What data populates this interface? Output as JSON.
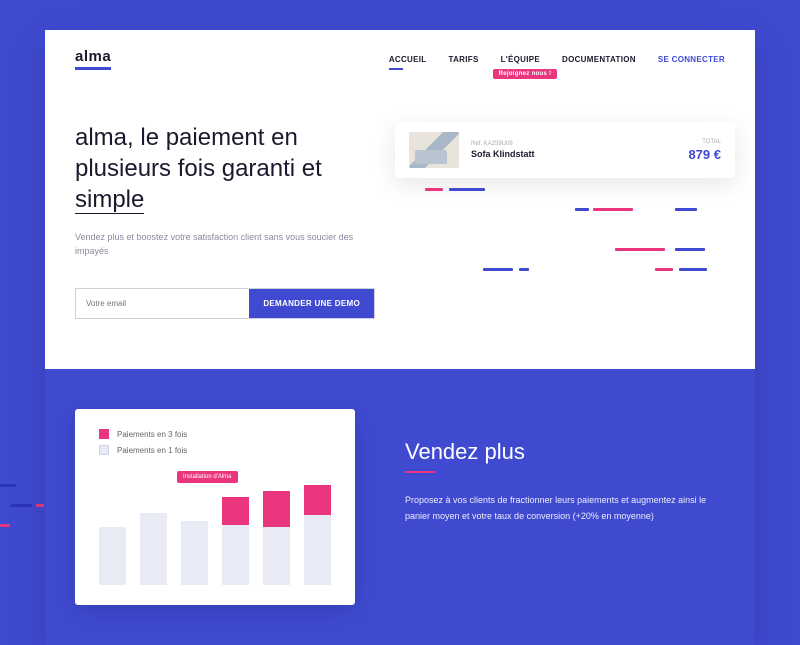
{
  "logo": "alma",
  "nav": {
    "accueil": "ACCUEIL",
    "tarifs": "TARIFS",
    "equipe": "L'ÉQUIPE",
    "equipe_badge": "Rejoignez nous !",
    "documentation": "DOCUMENTATION",
    "login": "SE CONNECTER"
  },
  "hero": {
    "title_part1": "alma, le paiement en plusieurs fois garanti et ",
    "title_underlined": "simple",
    "subtitle": "Vendez plus et boostez votre satisfaction client sans vous soucier des impayés",
    "email_placeholder": "Votre email",
    "demo_button": "DEMANDER UNE DEMO"
  },
  "product_card": {
    "ref": "Réf. KA259U09",
    "name": "Sofa Klindstatt",
    "total_label": "TOTAL",
    "price": "879 €"
  },
  "chart_data": {
    "type": "bar",
    "legend": [
      {
        "label": "Paiements en 3 fois",
        "color": "#e9367f"
      },
      {
        "label": "Paiements en 1 fois",
        "color": "#e8eaf5"
      }
    ],
    "annotation": "Installation d'Alma",
    "bars": [
      {
        "pink": 0,
        "blue": 58
      },
      {
        "pink": 0,
        "blue": 72
      },
      {
        "pink": 0,
        "blue": 64
      },
      {
        "pink": 28,
        "blue": 60
      },
      {
        "pink": 36,
        "blue": 58
      },
      {
        "pink": 30,
        "blue": 70
      }
    ]
  },
  "section2": {
    "title": "Vendez plus",
    "body": "Proposez à vos clients de fractionner leurs paiements et augmentez ainsi le panier moyen et votre taux de conversion (+20% en moyenne)"
  },
  "colors": {
    "primary": "#3f4ad1",
    "accent": "#e9367f"
  }
}
